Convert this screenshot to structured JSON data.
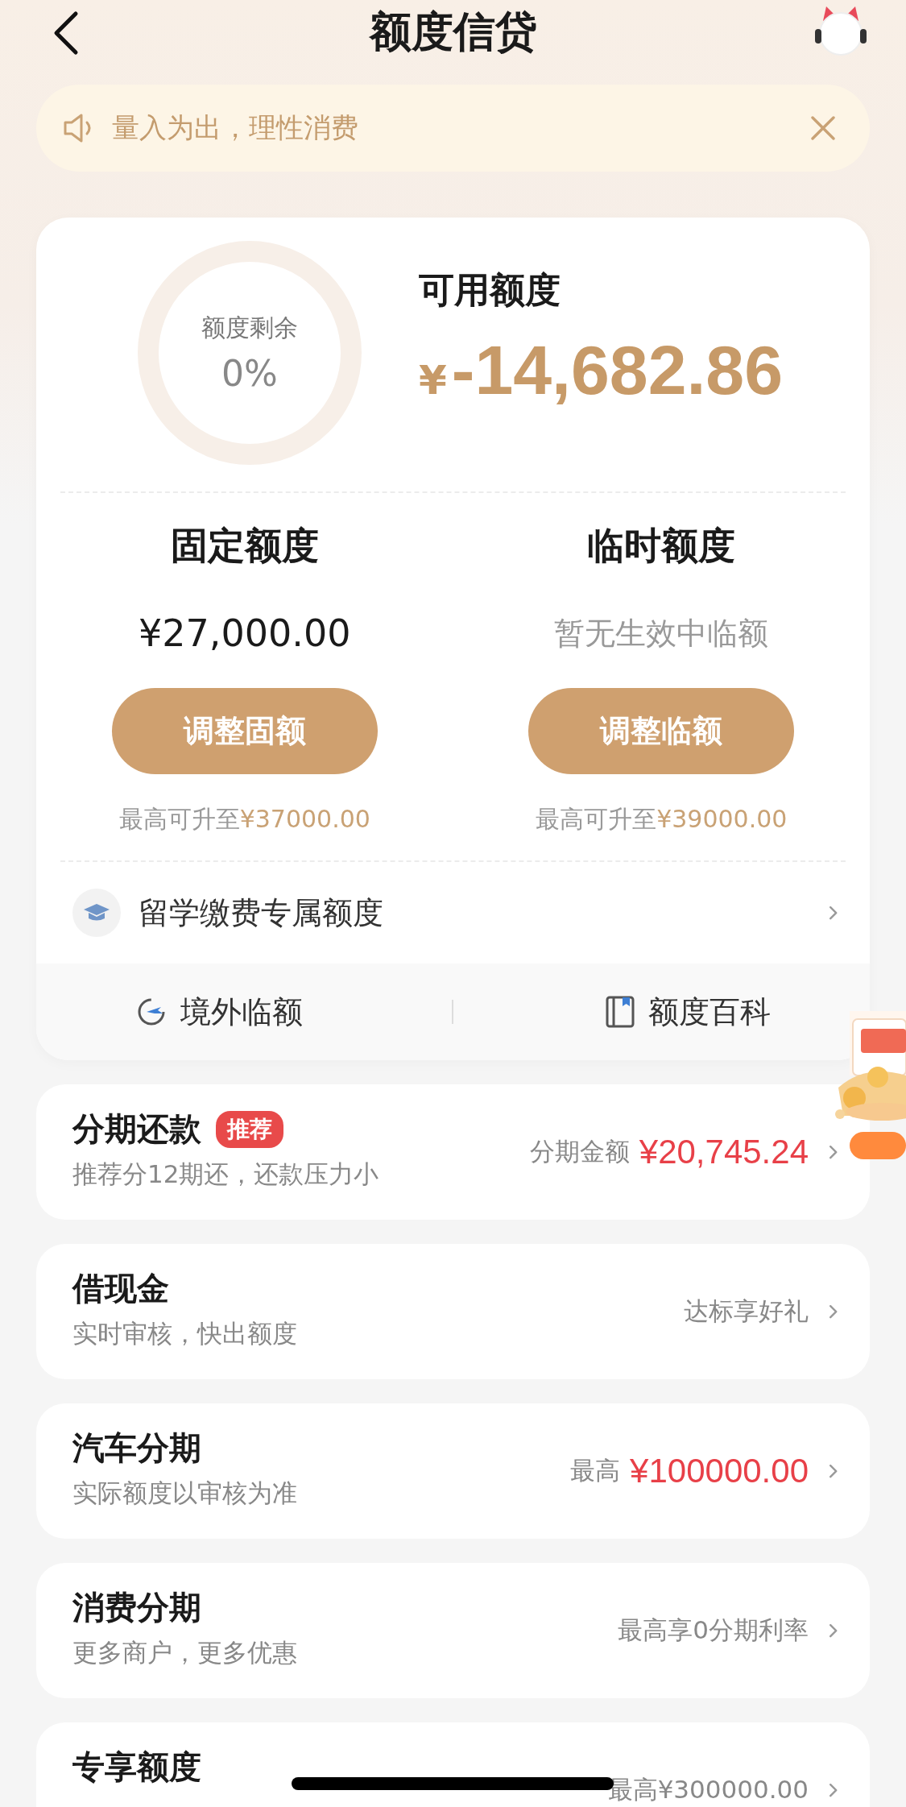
{
  "header": {
    "title": "额度信贷"
  },
  "notice": {
    "text": "量入为出，理性消费"
  },
  "quota": {
    "ring_label": "额度剩余",
    "ring_percent": "0%",
    "available_label": "可用额度",
    "currency": "¥",
    "available_amount": "-14,682.86"
  },
  "columns": [
    {
      "title": "固定额度",
      "kind": "amount",
      "value": "¥27,000.00",
      "button": "调整固额",
      "cap_label": "最高可升至",
      "cap_value": "¥37000.00"
    },
    {
      "title": "临时额度",
      "kind": "empty",
      "value": "暂无生效中临额",
      "button": "调整临额",
      "cap_label": "最高可升至",
      "cap_value": "¥39000.00"
    }
  ],
  "special_row": {
    "label": "留学缴费专属额度"
  },
  "shortcuts": [
    {
      "kind": "plane",
      "label": "境外临额"
    },
    {
      "kind": "book",
      "label": "额度百科"
    }
  ],
  "products": [
    {
      "title": "分期还款",
      "tag": "推荐",
      "subtitle": "推荐分12期还，还款压力小",
      "note": "分期金额",
      "amount": "¥20,745.24"
    },
    {
      "title": "借现金",
      "subtitle": "实时审核，快出额度",
      "note": "达标享好礼"
    },
    {
      "title": "汽车分期",
      "subtitle": "实际额度以审核为准",
      "note": "最高",
      "amount": "¥100000.00"
    },
    {
      "title": "消费分期",
      "subtitle": "更多商户，更多优惠",
      "note": "最高享0分期利率"
    },
    {
      "title": "专享额度",
      "note": "最高¥300000.00"
    }
  ]
}
